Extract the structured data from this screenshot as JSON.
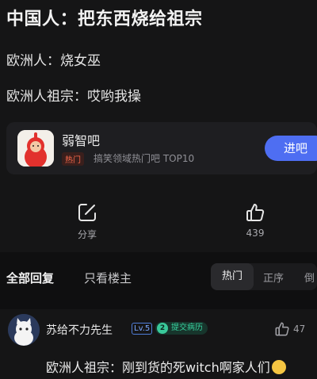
{
  "post": {
    "title": "中国人：把东西烧给祖宗",
    "line1": "欧洲人：烧女巫",
    "line2": "欧洲人祖宗：哎哟我操"
  },
  "bar": {
    "name": "弱智吧",
    "tag": "热门",
    "desc": "搞笑领域热门吧 TOP10",
    "enter_label": "进吧"
  },
  "actions": {
    "share_label": "分享",
    "like_count": "439"
  },
  "tabs": {
    "all": "全部回复",
    "op_only": "只看楼主",
    "sort_hot": "热门",
    "sort_asc": "正序",
    "sort_desc": "倒"
  },
  "comment": {
    "username": "苏给不力先生",
    "level": "Lv.5",
    "badge": "提交病历",
    "badge_icon_text": "2",
    "likes": "47",
    "text": "欧洲人祖宗：刚到货的死witch啊家人们"
  },
  "colors": {
    "accent": "#4e6ef2",
    "hot_tag": "#ff6b4d",
    "badge_green": "#38d39f"
  }
}
